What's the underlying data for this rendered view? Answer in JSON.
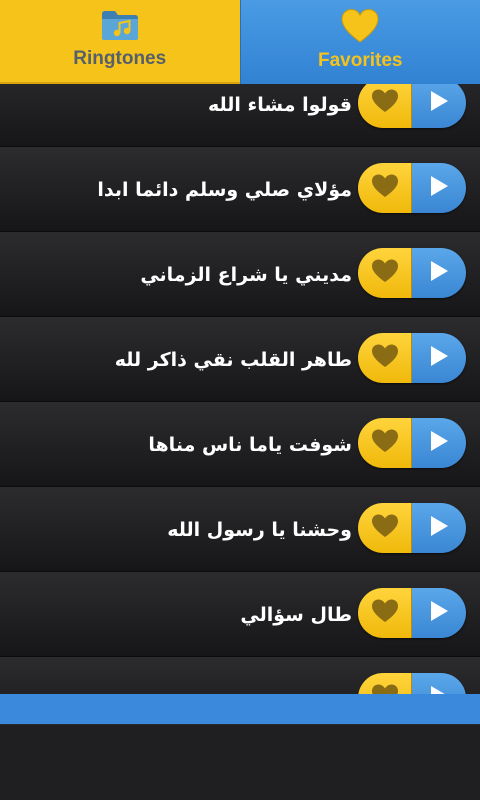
{
  "tabs": [
    {
      "label": "Ringtones",
      "icon": "folder-music-icon",
      "active": true
    },
    {
      "label": "Favorites",
      "icon": "heart-icon",
      "active": false
    }
  ],
  "colors": {
    "accent_yellow": "#f6c31b",
    "accent_blue": "#3a89dc",
    "background": "#1c1c1f"
  },
  "ringtones": [
    {
      "title": "قولوا مشاء الله"
    },
    {
      "title": "مؤلاي صلي وسلم دائما ابدا"
    },
    {
      "title": "مديني يا شراع الزماني"
    },
    {
      "title": "طاهر القلب نقي ذاكر لله"
    },
    {
      "title": "شوفت ياما ناس مناها"
    },
    {
      "title": "وحشنا يا رسول الله"
    },
    {
      "title": "طال سؤالي"
    },
    {
      "title": ""
    }
  ],
  "row_icons": {
    "favorite": "heart-icon",
    "play": "play-icon"
  }
}
